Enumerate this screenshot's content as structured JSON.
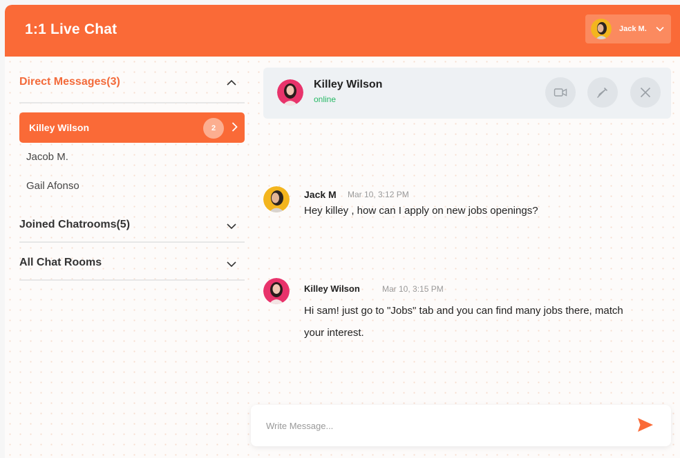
{
  "app": {
    "title": "1:1 Live Chat"
  },
  "current_user": {
    "name": "Jack M."
  },
  "sidebar": {
    "direct_messages": {
      "label": "Direct Messages(3)",
      "items": [
        {
          "name": "Killey Wilson",
          "unread": "2",
          "active": true
        },
        {
          "name": "Jacob M."
        },
        {
          "name": "Gail Afonso"
        }
      ]
    },
    "joined_chatrooms": {
      "label": "Joined Chatrooms(5)"
    },
    "all_chat_rooms": {
      "label": "All Chat Rooms"
    }
  },
  "chat": {
    "contact_name": "Killey Wilson",
    "status": "online",
    "messages": [
      {
        "author": "Jack M",
        "time": "Mar 10, 3:12 PM",
        "text": "Hey killey , how can I apply on new jobs openings?"
      },
      {
        "author": "Killey Wilson",
        "time": "Mar 10, 3:15 PM",
        "text": "Hi sam! just go to \"Jobs\" tab and you can find many jobs there, match your interest."
      }
    ]
  },
  "composer": {
    "placeholder": "Write Message..."
  },
  "colors": {
    "accent": "#fa6a37",
    "online": "#25b864",
    "header_panel": "#eef1f4"
  }
}
